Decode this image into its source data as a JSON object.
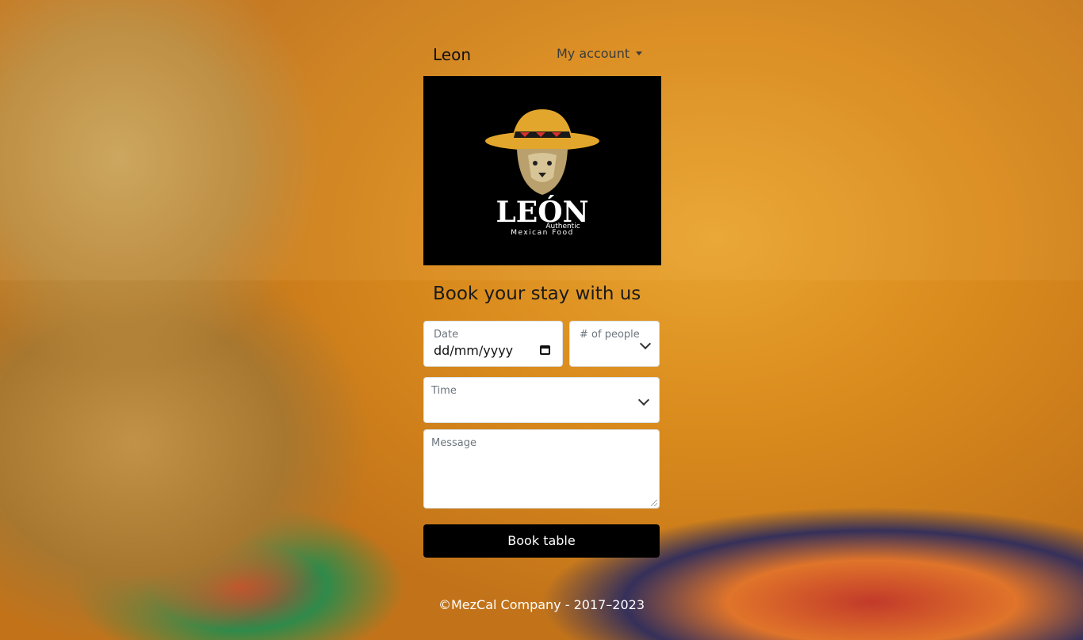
{
  "navbar": {
    "brand": "Leon",
    "account_label": "My account"
  },
  "logo": {
    "wordmark": "LEÓN",
    "tagline_1": "Authentic",
    "tagline_2": "Mexican Food"
  },
  "booking": {
    "heading": "Book your stay with us",
    "date_label": "Date",
    "date_value": "dd/mm/yyyy",
    "people_label": "# of people",
    "time_label": "Time",
    "message_label": "Message",
    "submit_label": "Book table"
  },
  "footer": {
    "copyright": "©MezCal Company - 2017–2023"
  },
  "colors": {
    "background": "#d98a1c",
    "button": "#000000",
    "field_bg": "#ffffff"
  }
}
